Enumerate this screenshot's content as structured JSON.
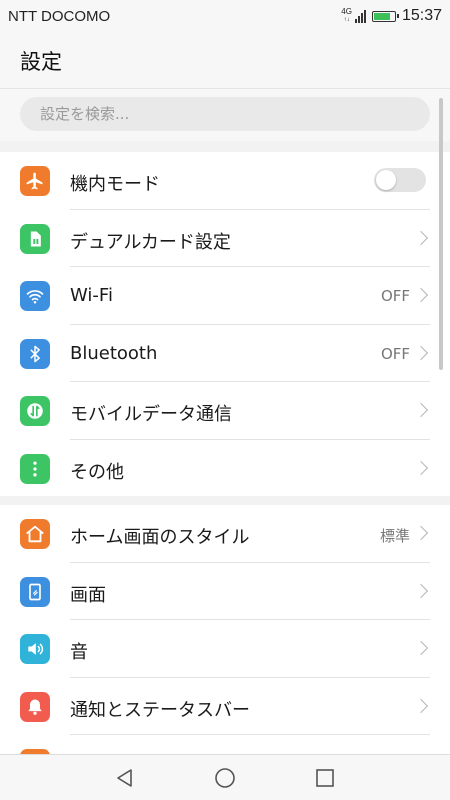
{
  "status_bar": {
    "carrier": "NTT DOCOMO",
    "network": "4G",
    "time": "15:37"
  },
  "header": {
    "title": "設定"
  },
  "search": {
    "placeholder": "設定を検索..."
  },
  "sections": [
    {
      "items": [
        {
          "label": "機内モード",
          "icon": "airplane-icon",
          "color": "#f07b2c",
          "control": "toggle",
          "toggle_on": false
        },
        {
          "label": "デュアルカード設定",
          "icon": "sim-card-icon",
          "color": "#3cc465",
          "control": "chevron"
        },
        {
          "label": "Wi-Fi",
          "icon": "wifi-icon",
          "color": "#3d8fe0",
          "control": "chevron",
          "value": "OFF"
        },
        {
          "label": "Bluetooth",
          "icon": "bluetooth-icon",
          "color": "#3d8fe0",
          "control": "chevron",
          "value": "OFF"
        },
        {
          "label": "モバイルデータ通信",
          "icon": "mobile-data-icon",
          "color": "#3cc465",
          "control": "chevron"
        },
        {
          "label": "その他",
          "icon": "more-icon",
          "color": "#3cc465",
          "control": "chevron"
        }
      ]
    },
    {
      "items": [
        {
          "label": "ホーム画面のスタイル",
          "icon": "home-icon",
          "color": "#f07b2c",
          "control": "chevron",
          "value": "標準"
        },
        {
          "label": "画面",
          "icon": "display-icon",
          "color": "#3d8fe0",
          "control": "chevron"
        },
        {
          "label": "音",
          "icon": "sound-icon",
          "color": "#2fb3d9",
          "control": "chevron"
        },
        {
          "label": "通知とステータスバー",
          "icon": "notification-icon",
          "color": "#f25c4f",
          "control": "chevron"
        }
      ]
    }
  ],
  "nav_bar": {
    "buttons": [
      "back-icon",
      "home-circle-icon",
      "recents-icon"
    ]
  }
}
